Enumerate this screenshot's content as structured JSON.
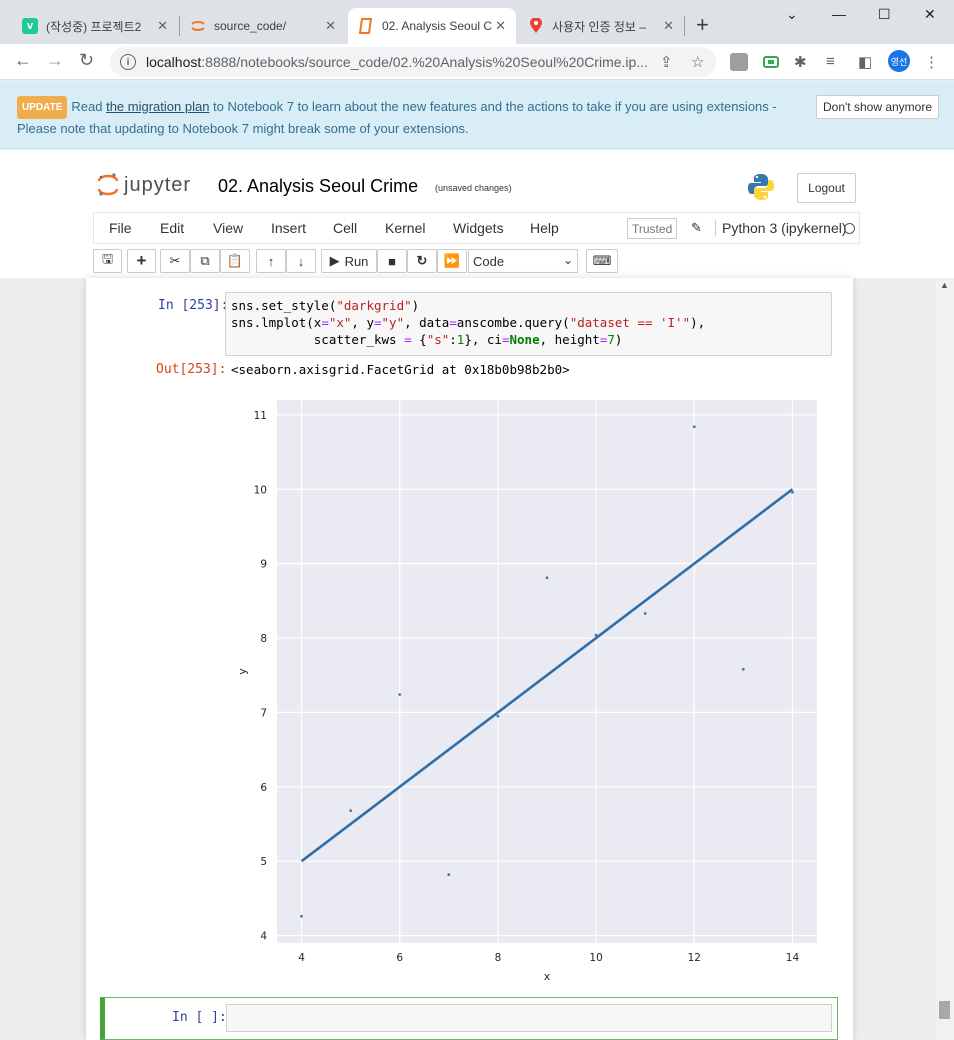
{
  "browser": {
    "tabs": [
      {
        "label": "(작성중) 프로젝트2",
        "icon": "v-app-icon",
        "color": "#20c997"
      },
      {
        "label": "source_code/",
        "icon": "jupyter-icon",
        "color": "#f37626"
      },
      {
        "label": "02. Analysis Seoul C",
        "icon": "notebook-icon",
        "color": "#f37626"
      },
      {
        "label": "사용자 인증 정보 –",
        "icon": "maps-icon",
        "color": "#ea4335"
      }
    ],
    "url_host": "localhost",
    "url_path": ":8888/notebooks/source_code/02.%20Analysis%20Seoul%20Crime.ip...",
    "profile_initials": "영선"
  },
  "banner": {
    "badge": "UPDATE",
    "text_before": "Read ",
    "link": "the migration plan",
    "text_after": " to Notebook 7 to learn about the new features and the actions to take if you are using extensions -",
    "line2": "Please note that updating to Notebook 7 might break some of your extensions.",
    "dismiss": "Don't show anymore"
  },
  "header": {
    "logo_text": "jupyter",
    "title": "02. Analysis Seoul Crime",
    "autosave": "(unsaved changes)",
    "logout": "Logout"
  },
  "menu": {
    "items": [
      "File",
      "Edit",
      "View",
      "Insert",
      "Cell",
      "Kernel",
      "Widgets",
      "Help"
    ],
    "trusted": "Trusted",
    "kernel": "Python 3 (ipykernel)"
  },
  "toolbar": {
    "run_label": "Run",
    "cell_type": "Code"
  },
  "cell1": {
    "in_prompt": "In [253]:",
    "out_prompt": "Out[253]:",
    "output_text": "<seaborn.axisgrid.FacetGrid at 0x18b0b98b2b0>"
  },
  "cell2": {
    "in_prompt": "In [ ]:"
  },
  "chart_data": {
    "type": "scatter",
    "xlabel": "x",
    "ylabel": "y",
    "xlim": [
      3.5,
      14.5
    ],
    "ylim": [
      3.9,
      11.2
    ],
    "xticks": [
      4,
      6,
      8,
      10,
      12,
      14
    ],
    "yticks": [
      4,
      5,
      6,
      7,
      8,
      9,
      10,
      11
    ],
    "grid": true,
    "style": "darkgrid",
    "point_color": "#4c72b0",
    "line_color": "#2e6faa",
    "points": [
      {
        "x": 4,
        "y": 4.26
      },
      {
        "x": 5,
        "y": 5.68
      },
      {
        "x": 6,
        "y": 7.24
      },
      {
        "x": 7,
        "y": 4.82
      },
      {
        "x": 8,
        "y": 6.95
      },
      {
        "x": 9,
        "y": 8.81
      },
      {
        "x": 10,
        "y": 8.04
      },
      {
        "x": 11,
        "y": 8.33
      },
      {
        "x": 12,
        "y": 10.84
      },
      {
        "x": 13,
        "y": 7.58
      },
      {
        "x": 14,
        "y": 9.96
      }
    ],
    "regression": {
      "x0": 4,
      "y0": 5.0,
      "x1": 14,
      "y1": 10.0
    }
  }
}
